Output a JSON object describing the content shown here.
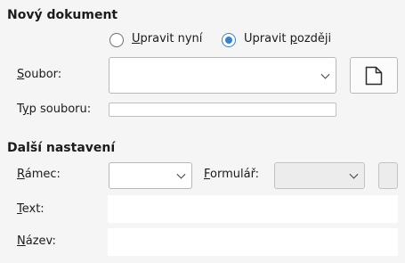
{
  "new_document": {
    "section_title": "Nový dokument",
    "radio_edit_now": {
      "label_accel": "U",
      "label_rest": "pravit nyní",
      "selected": false
    },
    "radio_edit_later": {
      "label_prefix": "Upravit ",
      "label_accel": "p",
      "label_rest": "ozději",
      "selected": true
    },
    "file_label_accel": "S",
    "file_label_rest": "oubor:",
    "file_value": "",
    "new_file_icon": "document-icon",
    "file_type_label_prefix": "T",
    "file_type_label_accel": "y",
    "file_type_label_rest": "p souboru:",
    "file_type_value": ""
  },
  "more_settings": {
    "section_title": "Další nastavení",
    "frame_label_accel": "R",
    "frame_label_rest": "ámec:",
    "frame_value": "",
    "form_label_accel": "F",
    "form_label_rest": "ormulář:",
    "form_value": "",
    "text_label_accel": "T",
    "text_label_rest": "ext:",
    "text_value": "",
    "name_label_accel": "N",
    "name_label_rest": "ázev:",
    "name_value": ""
  },
  "colors": {
    "background": "#f5f5f5",
    "accent": "#3a82c6"
  }
}
